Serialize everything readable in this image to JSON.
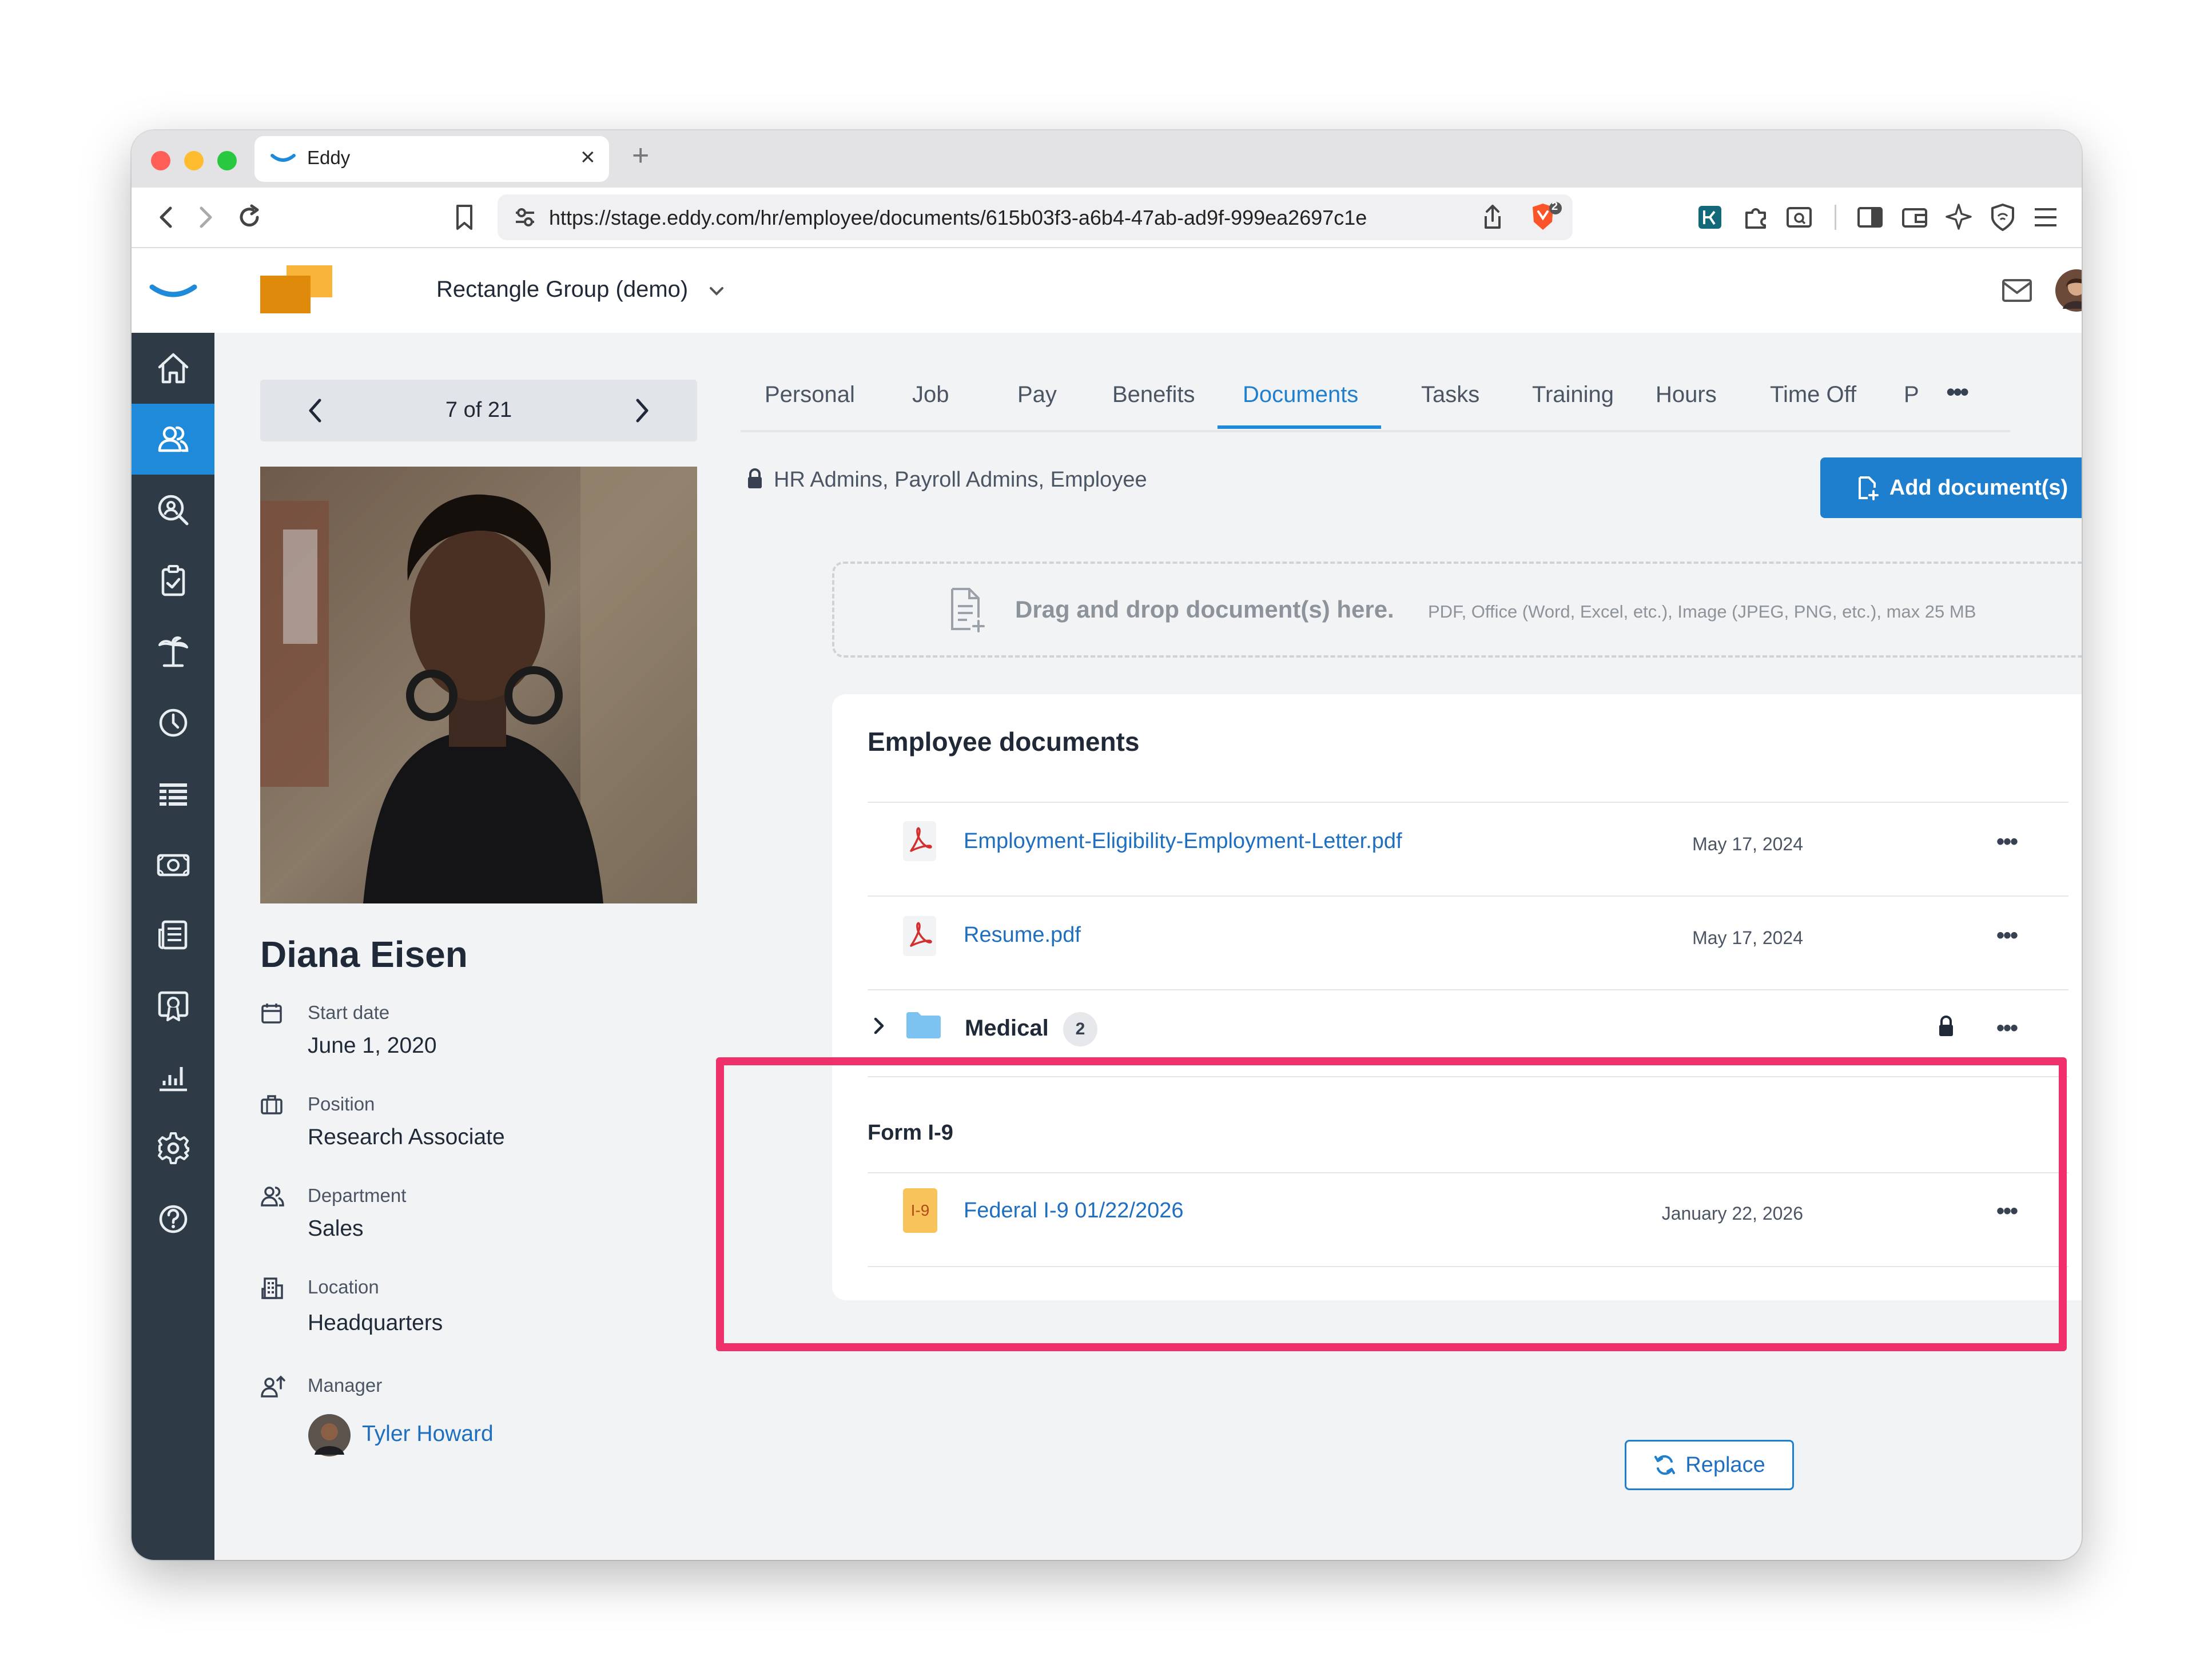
{
  "browser": {
    "tab_title": "Eddy",
    "close_glyph": "×",
    "new_tab_glyph": "+",
    "url": "https://stage.eddy.com/hr/employee/documents/615b03f3-a6b4-47ab-ad9f-999ea2697c1e",
    "shield_count": "2"
  },
  "header": {
    "company": "Rectangle Group (demo)"
  },
  "pager": {
    "label": "7 of 21"
  },
  "employee": {
    "name": "Diana Eisen",
    "fields": [
      {
        "label": "Start date",
        "value": "June 1, 2020"
      },
      {
        "label": "Position",
        "value": "Research Associate"
      },
      {
        "label": "Department",
        "value": "Sales"
      },
      {
        "label": "Location",
        "value": "Headquarters"
      },
      {
        "label": "Manager",
        "value": "Tyler Howard"
      }
    ]
  },
  "tabs": [
    "Personal",
    "Job",
    "Pay",
    "Benefits",
    "Documents",
    "Tasks",
    "Training",
    "Hours",
    "Time Off",
    "P"
  ],
  "more_glyph": "•••",
  "access": {
    "text": "HR Admins, Payroll Admins, Employee"
  },
  "add_button": {
    "label": "Add document(s)"
  },
  "dropzone": {
    "title": "Drag and drop document(s) here.",
    "hint": "PDF, Office (Word, Excel, etc.), Image (JPEG, PNG, etc.), max 25 MB"
  },
  "documents": {
    "title": "Employee documents",
    "files": [
      {
        "name": "Employment-Eligibility-Employment-Letter.pdf",
        "date": "May 17, 2024"
      },
      {
        "name": "Resume.pdf",
        "date": "May 17, 2024"
      }
    ],
    "folder": {
      "name": "Medical",
      "count": "2"
    },
    "row_menu_glyph": "•••"
  },
  "form_i9": {
    "title": "Form I-9",
    "badge": "I-9",
    "document": "Federal I-9 01/22/2026",
    "replace_label": "Replace",
    "date": "January 22, 2026"
  },
  "colors": {
    "accent": "#1f8ad9",
    "link": "#1f6fc0",
    "sidebar": "#2e3a45",
    "highlight": "#f0306a",
    "pdf_red": "#d32f2f",
    "i9_badge": "#f9c35c"
  }
}
